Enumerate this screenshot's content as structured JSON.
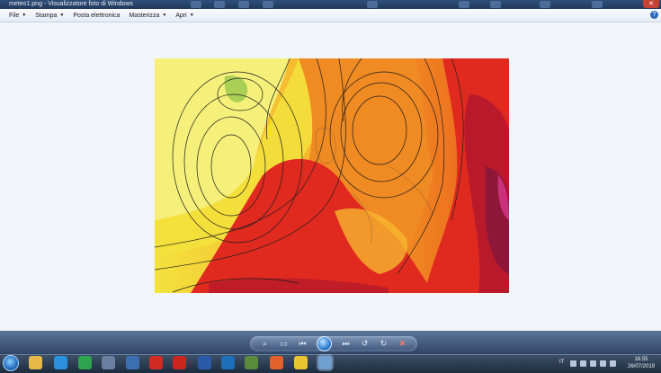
{
  "window": {
    "title": "meteo1.png - Visualizzatore foto di Windows",
    "close_label": "✕"
  },
  "menu": {
    "items": [
      "File",
      "Stampa",
      "Posta elettronica",
      "Masterizza",
      "Apri"
    ]
  },
  "help_label": "?",
  "map": {
    "image_subject": "weather-forecast-map-europe",
    "colors": {
      "yellow": "#f3e23c",
      "light_yellow": "#f6f07a",
      "orange_light": "#f6b52e",
      "orange": "#f08a22",
      "red_orange": "#ea5a1d",
      "red": "#e12a1f",
      "dark_red": "#b81a2b",
      "crimson": "#8e1638",
      "magenta": "#c8327a",
      "green": "#8fc44a",
      "isobar": "#1e1e1e"
    }
  },
  "viewer_toolbar": {
    "tools": [
      "magnifier-icon",
      "fit-icon",
      "previous-icon",
      "slideshow-icon",
      "next-icon",
      "rotate-left-icon",
      "rotate-right-icon",
      "delete-icon"
    ]
  },
  "taskbar": {
    "apps": [
      {
        "name": "explorer",
        "color": "#e7b84a"
      },
      {
        "name": "internet-explorer",
        "color": "#2b8fe0"
      },
      {
        "name": "chrome",
        "color": "#2ea44f"
      },
      {
        "name": "app-blue-red",
        "color": "#6a7fa1"
      },
      {
        "name": "app-globe",
        "color": "#3b6fb0"
      },
      {
        "name": "acrobat",
        "color": "#d22a25"
      },
      {
        "name": "acrobat-2",
        "color": "#c8261f"
      },
      {
        "name": "word",
        "color": "#2b5aa8"
      },
      {
        "name": "outlook",
        "color": "#1f6fb8"
      },
      {
        "name": "app-green",
        "color": "#5a8a3c"
      },
      {
        "name": "firefox",
        "color": "#e3602b"
      },
      {
        "name": "app-yellow",
        "color": "#e9c531"
      },
      {
        "name": "photo-viewer",
        "color": "#6fa0d0"
      }
    ],
    "tray": {
      "language": "IT",
      "time": "16.55",
      "date": "26/07/2019"
    }
  }
}
